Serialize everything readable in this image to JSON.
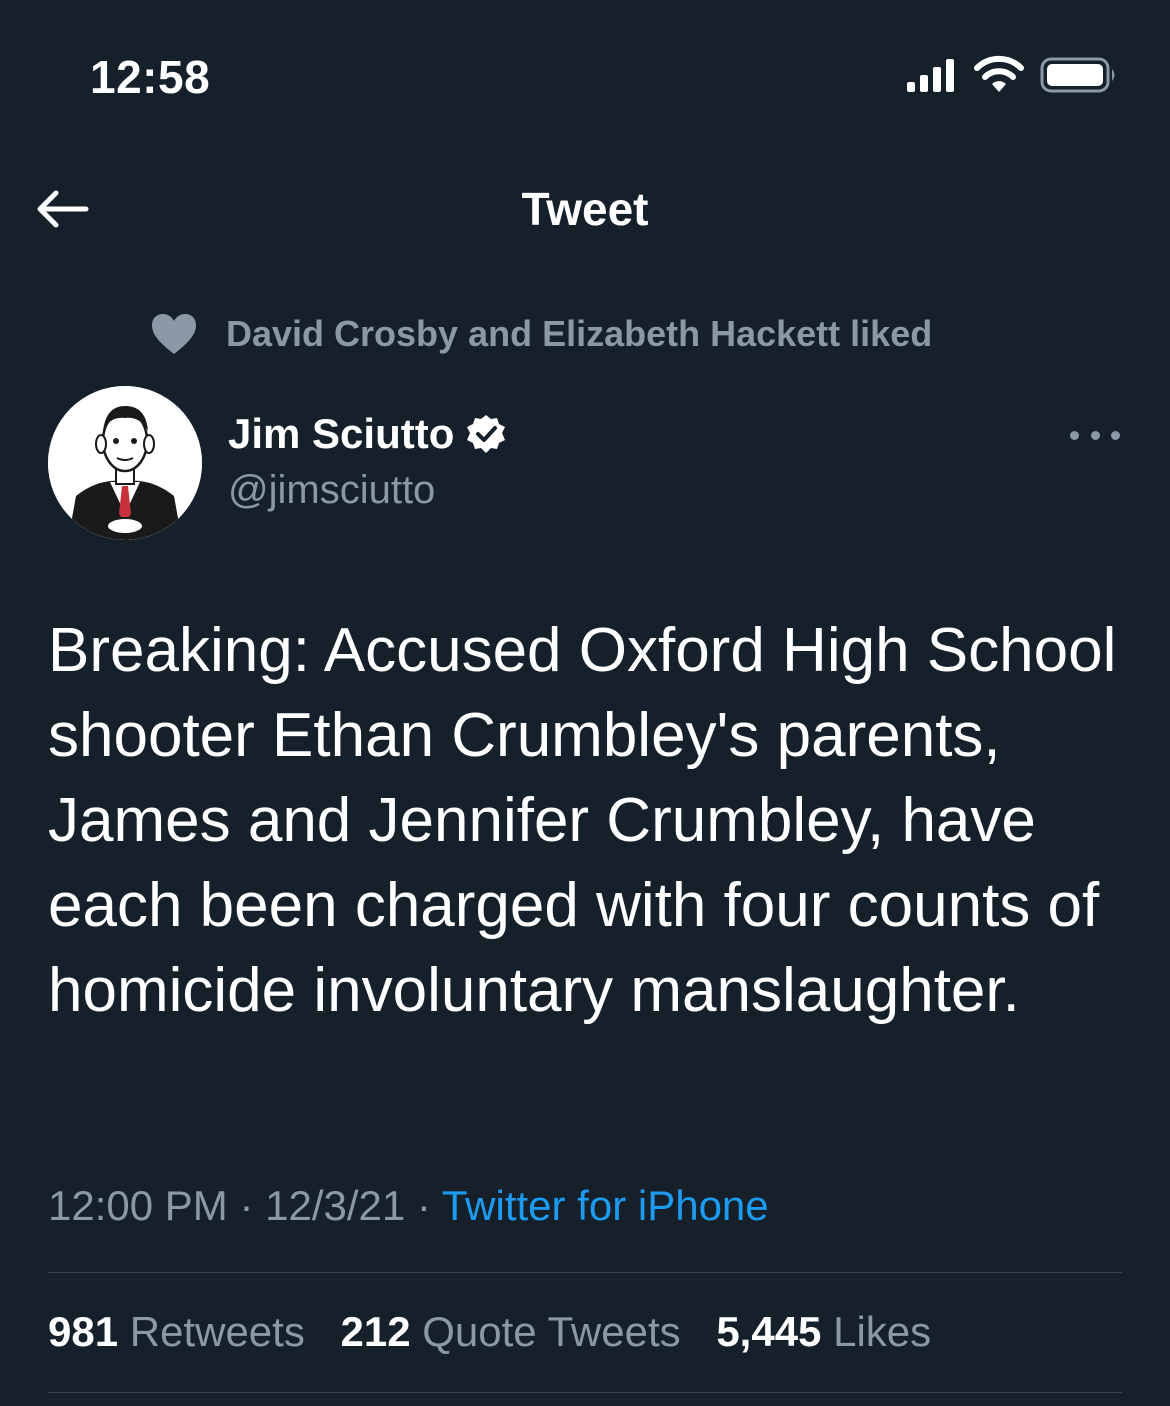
{
  "status_bar": {
    "time": "12:58"
  },
  "nav": {
    "title": "Tweet",
    "back_icon": "arrow-left-icon"
  },
  "social_context": {
    "icon": "heart-icon",
    "text": "David Crosby and Elizabeth Hackett liked"
  },
  "author": {
    "name": "Jim Sciutto",
    "handle": "@jimsciutto",
    "verified": true
  },
  "tweet": {
    "text": "Breaking: Accused Oxford High School shooter Ethan Crumbley's parents, James and Jennifer Crumbley, have each been charged with four counts of homicide involuntary manslaughter.",
    "time": "12:00 PM",
    "separator": " · ",
    "date": "12/3/21",
    "source": "Twitter for iPhone"
  },
  "stats": {
    "retweets_count": "981",
    "retweets_label": "Retweets",
    "quotes_count": "212",
    "quotes_label": "Quote Tweets",
    "likes_count": "5,445",
    "likes_label": "Likes"
  },
  "colors": {
    "background": "#15202b",
    "secondary_text": "#8b98a5",
    "accent": "#1d9bf0",
    "divider": "#38444d"
  }
}
